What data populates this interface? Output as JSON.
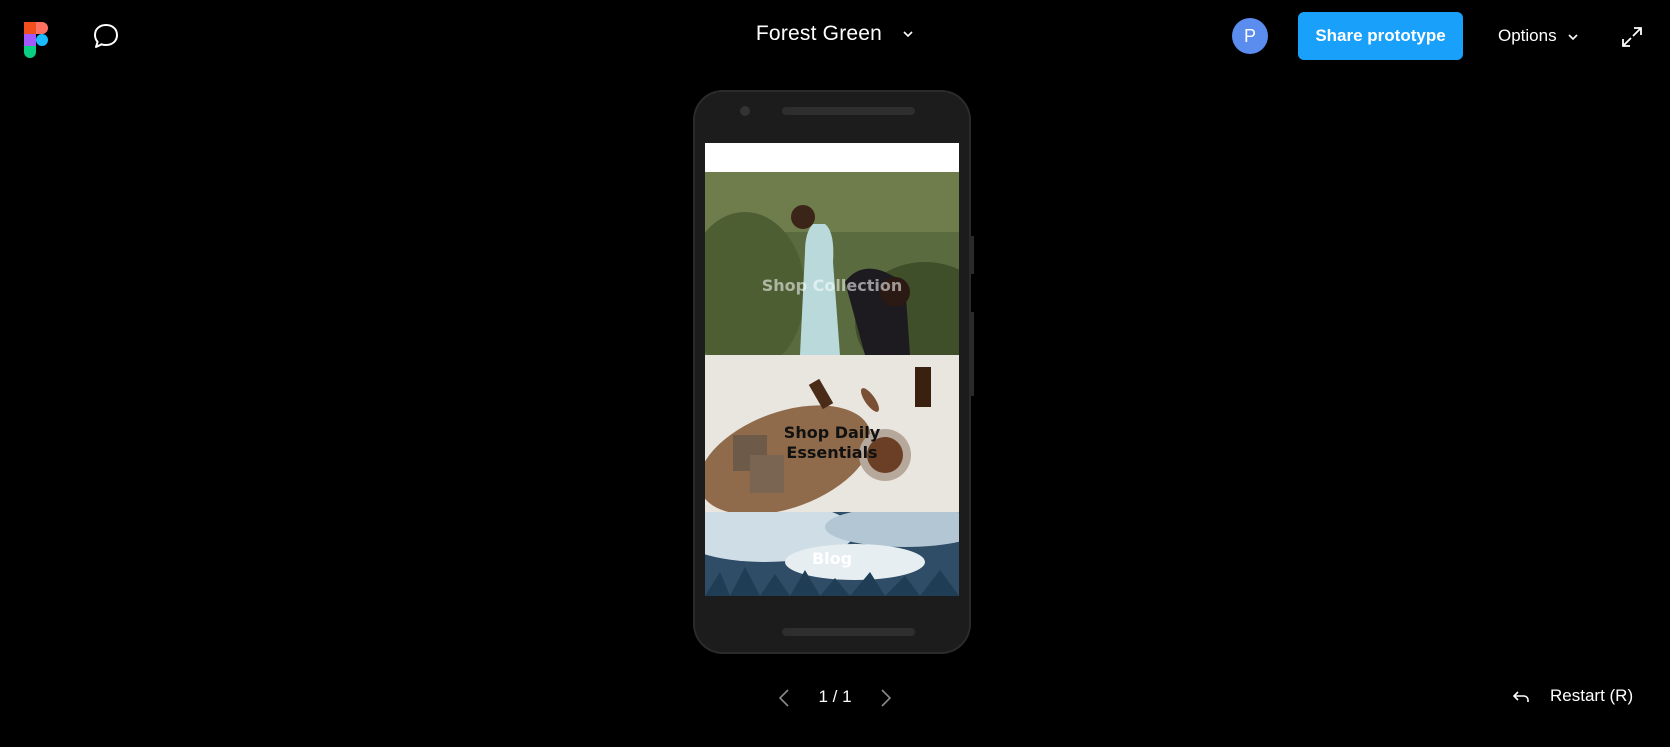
{
  "toolbar": {
    "file_title": "Forest Green",
    "avatar_initial": "P",
    "share_label": "Share prototype",
    "options_label": "Options",
    "logo_icon": "figma-logo-icon",
    "comment_icon": "comment-bubble-icon",
    "expand_icon": "expand-icon",
    "share_color": "#18a0fb",
    "avatar_color": "#5b8def"
  },
  "screen": {
    "tiles": [
      {
        "label": "Shop Collection"
      },
      {
        "label": "Shop Daily\nEssentials"
      },
      {
        "label": "Blog"
      }
    ]
  },
  "pager": {
    "count": "1 / 1"
  },
  "footer": {
    "restart_label": "Restart (R)",
    "restart_icon": "undo-arrow-icon"
  }
}
